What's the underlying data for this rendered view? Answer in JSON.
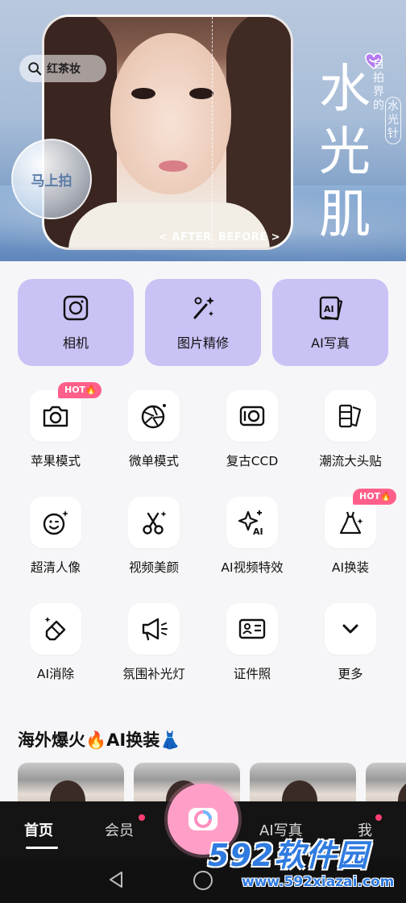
{
  "banner": {
    "search_chip": "红茶妆",
    "shoot_now": "马上拍",
    "after_label": "< AFTER",
    "before_label": "BEFORE >",
    "title": "水光肌",
    "side_text": "自拍界的",
    "side_text_boxed": "水光针"
  },
  "primary": [
    {
      "label": "相机",
      "icon": "camera-icon"
    },
    {
      "label": "图片精修",
      "icon": "magic-wand-icon"
    },
    {
      "label": "AI写真",
      "icon": "ai-portrait-icon"
    }
  ],
  "tools": [
    [
      {
        "label": "苹果模式",
        "icon": "camera-icon",
        "badge": "HOT🔥"
      },
      {
        "label": "微单模式",
        "icon": "aperture-icon"
      },
      {
        "label": "复古CCD",
        "icon": "ccd-camera-icon"
      },
      {
        "label": "潮流大头贴",
        "icon": "photo-strip-icon"
      }
    ],
    [
      {
        "label": "超清人像",
        "icon": "smiley-sparkle-icon"
      },
      {
        "label": "视频美颜",
        "icon": "scissors-icon"
      },
      {
        "label": "AI视频特效",
        "icon": "ai-sparkle-icon"
      },
      {
        "label": "AI换装",
        "icon": "dress-icon",
        "badge": "HOT🔥"
      }
    ],
    [
      {
        "label": "AI消除",
        "icon": "eraser-icon"
      },
      {
        "label": "氛围补光灯",
        "icon": "megaphone-light-icon"
      },
      {
        "label": "证件照",
        "icon": "id-card-icon"
      },
      {
        "label": "更多",
        "icon": "chevron-down-icon"
      }
    ]
  ],
  "section_title": "海外爆火🔥AI换装👗",
  "tabbar": {
    "home": "首页",
    "vip": "会员",
    "ai": "AI写真",
    "me": "我"
  },
  "watermark": {
    "big": "592软件园",
    "small": "www.592xiazai.com"
  },
  "colors": {
    "primary_button": "#c9c2f5",
    "hot_badge": "#ff5f8a",
    "tabbar": "#141414",
    "center_button": "#ff9fc8"
  }
}
